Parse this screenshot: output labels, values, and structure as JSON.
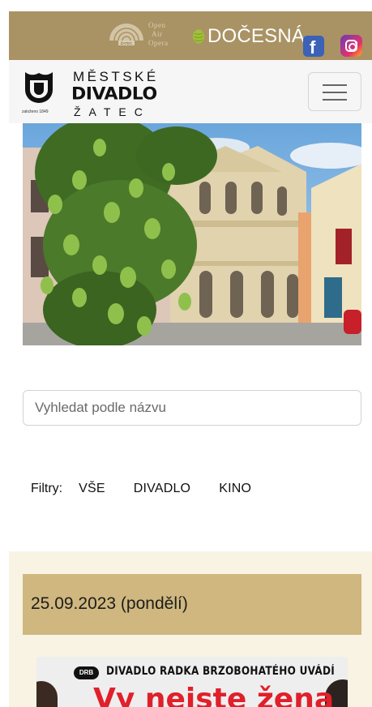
{
  "topbar": {
    "oao_lines": [
      "Open",
      "Air",
      "Opera"
    ],
    "oao_badge": "ŽATEC",
    "docesna_label": "DOČESNÁ",
    "facebook_glyph": "f",
    "icons": [
      "theatre-shell-icon",
      "hop-icon",
      "facebook-icon",
      "instagram-icon"
    ],
    "colors": {
      "bar": "#a99264",
      "facebook": "#3b62b5"
    }
  },
  "header": {
    "brand_top": "MĚSTSKÉ",
    "brand_mid": "DIVADLO",
    "brand_bot": "ŽATEC",
    "logo_small": "založeno 1849",
    "menu_icon": "hamburger-icon"
  },
  "search": {
    "placeholder": "Vyhledat podle názvu",
    "value": ""
  },
  "filters": {
    "label": "Filtry:",
    "options": [
      "VŠE",
      "DIVADLO",
      "KINO"
    ]
  },
  "listing": {
    "date": "25.09.2023 (pondělí)",
    "poster": {
      "badge": "DRB",
      "presenter": "DIVADLO RADKA BRZOBOHATÉHO UVÁDÍ",
      "title": "Vy nejste žena"
    },
    "colors": {
      "date_bar": "#cfb77f",
      "background": "#f8f3e3"
    }
  }
}
